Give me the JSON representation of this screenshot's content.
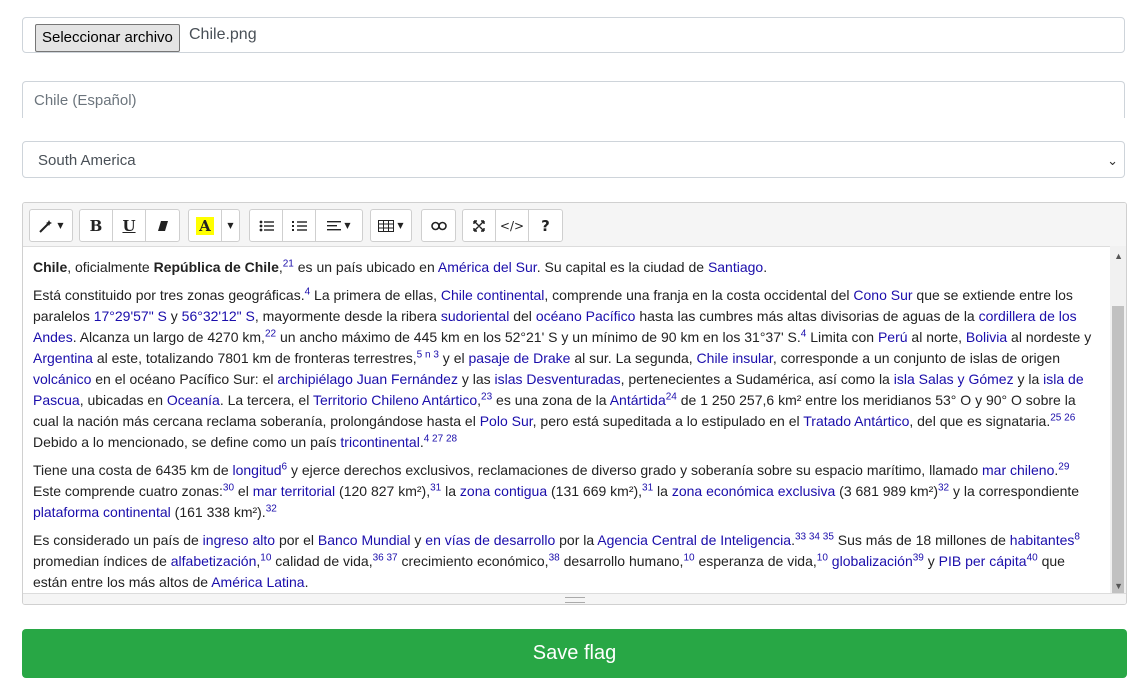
{
  "file": {
    "button_label": "Seleccionar archivo",
    "file_name": "Chile.png"
  },
  "name_input": {
    "placeholder": "Chile (Español)"
  },
  "region_select": {
    "value": "South America"
  },
  "toolbar": {
    "magic_icon": "magic-wand-icon",
    "bold": "B",
    "underline": "U",
    "eraser_icon": "eraser-icon",
    "color_label": "A",
    "help": "?",
    "code": "</>"
  },
  "content": {
    "p1": {
      "b1": "Chile",
      "t1": ", oficialmente ",
      "b2": "República de Chile",
      "t2": ",",
      "s1": "21",
      "t3": " es un país ubicado en ",
      "l1": "América del Sur",
      "t4": ". Su capital es la ciudad de ",
      "l2": "Santiago",
      "t5": "."
    },
    "p2": {
      "a": "Está constituido por tres zonas geográficas.",
      "s1": "4",
      "b": " La primera de ellas, ",
      "l1": "Chile continental",
      "c": ", comprende una franja en la costa occidental del ",
      "l2": "Cono Sur",
      "d": " que se extiende entre los paralelos ",
      "l3": "17°29'57\" S",
      "e": " y ",
      "l4": "56°32'12\" S",
      "f": ", mayormente desde la ribera ",
      "l5": "sudoriental",
      "g": " del ",
      "l6": "océano Pacífico",
      "h": " hasta las cumbres más altas divisorias de aguas de la ",
      "l7": "cordillera de los Andes",
      "i": ". Alcanza un largo de 4270 km,",
      "s2": "22",
      "j": " un ancho máximo de 445 km en los 52°21' S y un mínimo de 90 km en los 31°37' S.",
      "s3": "4",
      "k": " Limita con ",
      "l8": "Perú",
      "m": " al norte, ",
      "l9": "Bolivia",
      "n": " al nordeste y ",
      "l10": "Argentina",
      "o": " al este, totalizando 7801 km de fronteras terrestres,",
      "s4": "5 n 3",
      "p": " y el ",
      "l11": "pasaje de Drake",
      "q": " al sur. La segunda, ",
      "l12": "Chile insular",
      "r": ", corresponde a un conjunto de islas de origen ",
      "l13": "volcánico",
      "s": " en el océano Pacífico Sur: el ",
      "l14": "archipiélago Juan Fernández",
      "t": " y las ",
      "l15": "islas Desventuradas",
      "u": ", pertenecientes a Sudamérica, así como la ",
      "l16": "isla Salas y Gómez",
      "v": " y la ",
      "l17": "isla de Pascua",
      "w": ", ubicadas en ",
      "l18": "Oceanía",
      "x": ". La tercera, el ",
      "l19": "Territorio Chileno Antártico",
      "y": ",",
      "s5": "23",
      "z": " es una zona de la ",
      "l20": "Antártida",
      "s6": "24",
      "aa": " de 1 250 257,6 km² entre los meridianos 53° O y 90° O sobre la cual la nación más cercana reclama soberanía, prolongándose hasta el ",
      "l21": "Polo Sur",
      "bb": ", pero está supeditada a lo estipulado en el ",
      "l22": "Tratado Antártico",
      "cc": ", del que es signataria.",
      "s7": "25 26",
      "dd": " Debido a lo mencionado, se define como un país ",
      "l23": "tricontinental",
      "ee": ".",
      "s8": "4 27 28"
    },
    "p3": {
      "a": "Tiene una costa de 6435 km de ",
      "l1": "longitud",
      "s1": "6",
      "b": " y ejerce derechos exclusivos, reclamaciones de diverso grado y soberanía sobre su espacio marítimo, llamado ",
      "l2": "mar chileno",
      "c": ".",
      "s2": "29",
      "d": " Este comprende cuatro zonas:",
      "s3": "30",
      "e": " el ",
      "l3": "mar territorial",
      "f": " (120 827 km²),",
      "s4": "31",
      "g": " la ",
      "l4": "zona contigua",
      "h": " (131 669 km²),",
      "s5": "31",
      "i": " la ",
      "l5": "zona económica exclusiva",
      "j": " (3 681 989 km²)",
      "s6": "32",
      "k": " y la correspondiente ",
      "l6": "plataforma continental",
      "m": " (161 338 km²).",
      "s7": "32"
    },
    "p4": {
      "a": "Es considerado un país de ",
      "l1": "ingreso alto",
      "b": " por el ",
      "l2": "Banco Mundial",
      "c": " y ",
      "l3": "en vías de desarrollo",
      "d": " por la ",
      "l4": "Agencia Central de Inteligencia",
      "e": ".",
      "s1": "33 34 35",
      "f": " Sus más de 18 millones de ",
      "l5": "habitantes",
      "s2": "8",
      "g": " promedian índices de ",
      "l6": "alfabetización",
      "h": ",",
      "s3": "10",
      "i": " calidad de vida,",
      "s4": "36 37",
      "j": " crecimiento económico,",
      "s5": "38",
      "k": " desarrollo humano,",
      "s6": "10",
      "m": " esperanza de vida,",
      "s7": "10",
      "l7": "globalización",
      "s8": "39",
      "n": " y ",
      "l8": "PIB per cápita",
      "s9": "40",
      "o": " que están entre los más altos de ",
      "l9": "América Latina",
      "p": "."
    }
  },
  "save_button": {
    "label": "Save flag"
  },
  "colors": {
    "save": "#28a745",
    "link": "#1a0dab",
    "highlight": "#ffff00"
  }
}
